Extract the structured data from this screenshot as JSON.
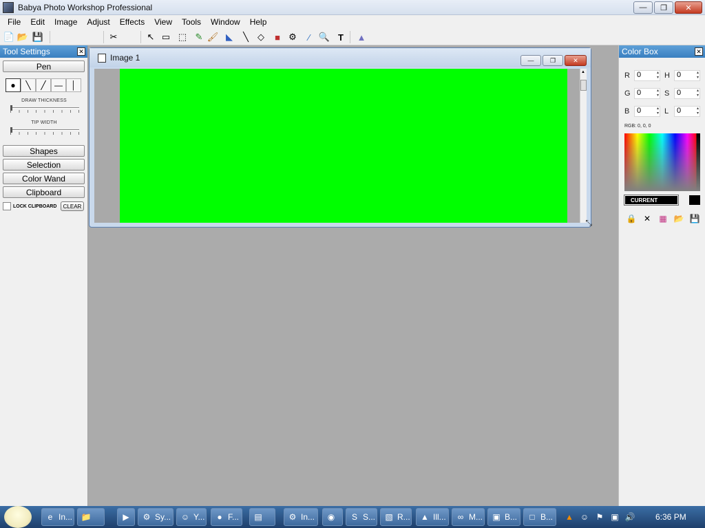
{
  "app": {
    "title": "Babya Photo Workshop Professional"
  },
  "menu": [
    "File",
    "Edit",
    "Image",
    "Adjust",
    "Effects",
    "View",
    "Tools",
    "Window",
    "Help"
  ],
  "tool_settings": {
    "title": "Tool Settings",
    "pen_label": "Pen",
    "draw_thickness_label": "DRAW THICKNESS",
    "tip_width_label": "TIP WIDTH",
    "draw_thickness_value": 0.0,
    "tip_width_value": 0.0,
    "sections": [
      "Shapes",
      "Selection",
      "Color Wand",
      "Clipboard"
    ],
    "lock_clipboard_label": "LOCK CLIPBOARD",
    "clear_label": "CLEAR"
  },
  "image_window": {
    "title": "Image 1",
    "canvas_color": "#00ff00"
  },
  "color_box": {
    "title": "Color Box",
    "fields": [
      {
        "letter": "R",
        "value": "0"
      },
      {
        "letter": "H",
        "value": "0"
      },
      {
        "letter": "G",
        "value": "0"
      },
      {
        "letter": "S",
        "value": "0"
      },
      {
        "letter": "B",
        "value": "0"
      },
      {
        "letter": "L",
        "value": "0"
      }
    ],
    "rgb_readout": "RGB: 0, 0, 0",
    "current_label": "CURRENT",
    "current_color": "#000000"
  },
  "taskbar": {
    "items": [
      {
        "label": "In...",
        "icon": "ie-icon"
      },
      {
        "label": "",
        "icon": "folder-icon"
      },
      {
        "label": "",
        "icon": "media-player-icon"
      },
      {
        "label": "Sy...",
        "icon": "system-icon"
      },
      {
        "label": "Y...",
        "icon": "yahoo-messenger-icon"
      },
      {
        "label": "F...",
        "icon": "firefox-icon"
      },
      {
        "label": "",
        "icon": "winrar-icon"
      },
      {
        "label": "In...",
        "icon": "installer-icon"
      },
      {
        "label": "",
        "icon": "chrome-icon"
      },
      {
        "label": "S...",
        "icon": "red-app-icon"
      },
      {
        "label": "R...",
        "icon": "document-icon"
      },
      {
        "label": "Ill...",
        "icon": "vlc-icon"
      },
      {
        "label": "M...",
        "icon": "infinity-icon"
      },
      {
        "label": "B...",
        "icon": "babya-icon"
      },
      {
        "label": "B...",
        "icon": "window-icon"
      }
    ],
    "clock": "6:36 PM"
  }
}
